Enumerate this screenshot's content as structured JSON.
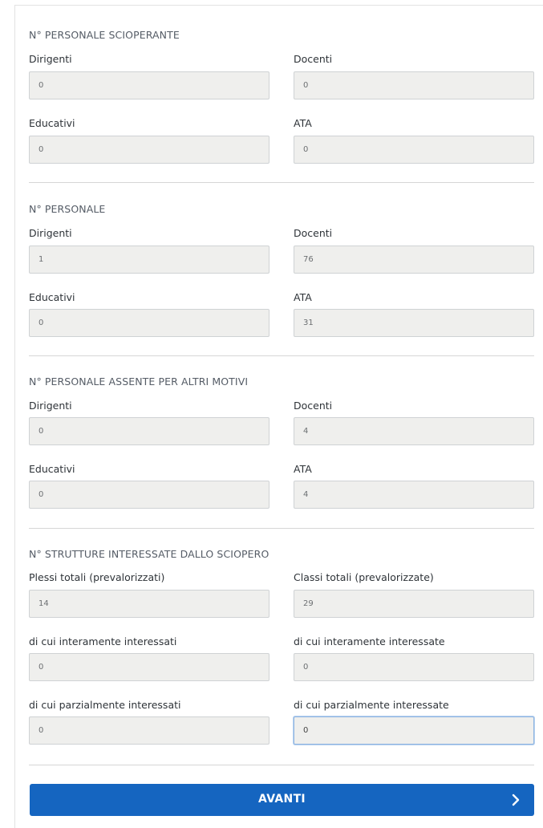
{
  "sections": [
    {
      "title": "N° PERSONALE SCIOPERANTE",
      "fields": [
        {
          "label": "Dirigenti",
          "value": "0"
        },
        {
          "label": "Docenti",
          "value": "0"
        },
        {
          "label": "Educativi",
          "value": "0"
        },
        {
          "label": "ATA",
          "value": "0"
        }
      ]
    },
    {
      "title": "N° PERSONALE",
      "fields": [
        {
          "label": "Dirigenti",
          "value": "1"
        },
        {
          "label": "Docenti",
          "value": "76"
        },
        {
          "label": "Educativi",
          "value": "0"
        },
        {
          "label": "ATA",
          "value": "31"
        }
      ]
    },
    {
      "title": "N° PERSONALE ASSENTE PER ALTRI MOTIVI",
      "fields": [
        {
          "label": "Dirigenti",
          "value": "0"
        },
        {
          "label": "Docenti",
          "value": "4"
        },
        {
          "label": "Educativi",
          "value": "0"
        },
        {
          "label": "ATA",
          "value": "4"
        }
      ]
    },
    {
      "title": "N° STRUTTURE INTERESSATE DALLO SCIOPERO",
      "fields": [
        {
          "label": "Plessi totali (prevalorizzati)",
          "value": "14"
        },
        {
          "label": "Classi totali (prevalorizzate)",
          "value": "29"
        },
        {
          "label": "di cui interamente interessati",
          "value": "0"
        },
        {
          "label": "di cui interamente interessate",
          "value": "0"
        },
        {
          "label": "di cui parzialmente interessati",
          "value": "0"
        },
        {
          "label": "di cui parzialmente interessate",
          "value": "0"
        }
      ]
    }
  ],
  "submit": {
    "label": "AVANTI",
    "icon": "chevron-right-icon",
    "color": "#1565c0"
  },
  "colors": {
    "input_bg": "#efefed",
    "input_border": "#cfd2d4",
    "focus_border": "#8fb5e2"
  }
}
